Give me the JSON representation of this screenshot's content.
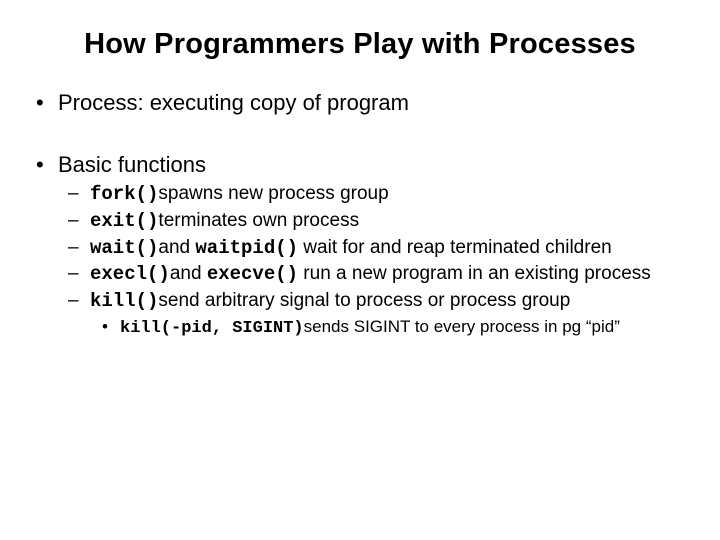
{
  "title": "How Programmers Play with Processes",
  "b1": "Process: executing copy of program",
  "b2": "Basic functions",
  "s1c": "fork()",
  "s1t": "spawns new  process group",
  "s2c": "exit()",
  "s2t": "terminates own process",
  "s3c1": "wait()",
  "s3t1": "and ",
  "s3c2": "waitpid()",
  "s3t2": " wait for and reap terminated children",
  "s4c1": "execl()",
  "s4t1": "and ",
  "s4c2": "execve()",
  "s4t2": " run a new program in an existing process",
  "s5c": "kill()",
  "s5t": "send arbitrary signal to process or process group",
  "t1c": "kill(-pid, SIGINT)",
  "t1t": "sends SIGINT to every process in pg “pid”"
}
